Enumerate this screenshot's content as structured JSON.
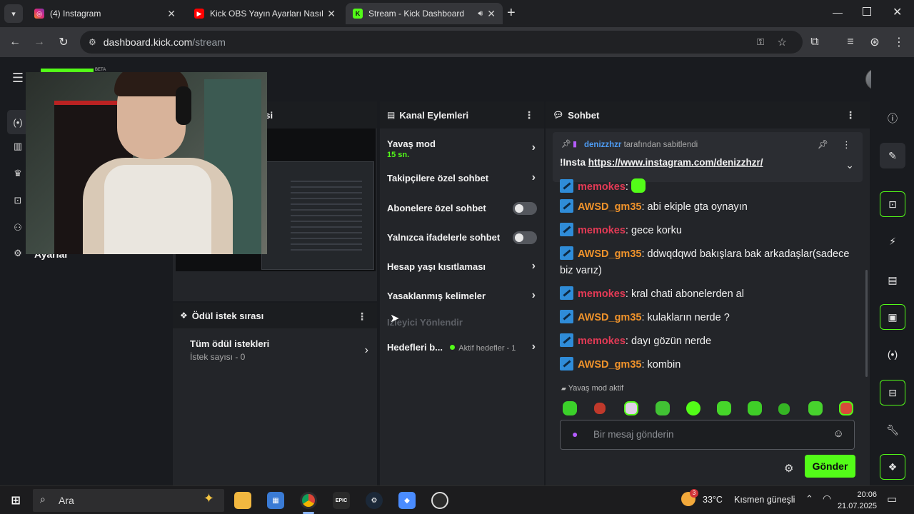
{
  "browser": {
    "tabs": [
      {
        "title": "(4) Instagram",
        "favicon": "instagram-icon",
        "color": "#d6249f"
      },
      {
        "title": "Kick OBS Yayın Ayarları Nasıl Ya",
        "favicon": "youtube-icon",
        "color": "#ff0000"
      },
      {
        "title": "Stream - Kick Dashboard",
        "favicon": "kick-icon",
        "color": "#53fc18"
      }
    ],
    "url_host": "dashboard.kick.com",
    "url_path": "/stream",
    "new_tab": "+"
  },
  "leftnav": {
    "partial_label": "Ayarlar",
    "beta_label": "BETA"
  },
  "stream_panel": {
    "title_partial": "asi"
  },
  "rewards_panel": {
    "title": "Ödül istek sırası",
    "item_title": "Tüm ödül istekleri",
    "item_sub": "İstek sayısı - 0"
  },
  "actions_panel": {
    "title": "Kanal Eylemleri",
    "slow_mode": {
      "label": "Yavaş mod",
      "value": "15 sn."
    },
    "rows": [
      {
        "label": "Takipçilere özel sohbet"
      },
      {
        "label": "Abonelere özel sohbet"
      },
      {
        "label": "Yalnızca ifadelerle sohbet"
      },
      {
        "label": "Hesap yaşı kısıtlaması"
      },
      {
        "label": "Yasaklanmış kelimeler"
      }
    ],
    "disabled_row": "Izleyici Yönlendir",
    "goals": {
      "label": "Hedefleri b...",
      "status": "Aktif hedefler - 1"
    }
  },
  "chat": {
    "title": "Sohbet",
    "pinned_by_user": "denizzhzr",
    "pinned_by_text": "tarafından sabitlendi",
    "pinned_prefix": "!Insta",
    "pinned_link": "https://www.instagram.com/denizzhzr/",
    "messages": [
      {
        "user": "memokes",
        "color": "red",
        "text": ""
      },
      {
        "user": "AWSD_gm35",
        "color": "orange",
        "text": "abi ekiple gta oynayın"
      },
      {
        "user": "memokes",
        "color": "red",
        "text": "gece korku"
      },
      {
        "user": "AWSD_gm35",
        "color": "orange",
        "text": "ddwqdqwd bakışlara bak arkadaşlar(sadece biz varız)"
      },
      {
        "user": "memokes",
        "color": "red",
        "text": "kral chati abonelerden al"
      },
      {
        "user": "AWSD_gm35",
        "color": "orange",
        "text": "kulakların nerde ?"
      },
      {
        "user": "memokes",
        "color": "red",
        "text": "dayı gözün nerde"
      },
      {
        "user": "AWSD_gm35",
        "color": "orange",
        "text": "kombin"
      }
    ],
    "slow_mode_notice": "Yavaş mod aktif",
    "input_placeholder": "Bir mesaj gönderin",
    "send_label": "Gönder"
  },
  "taskbar": {
    "search_placeholder": "Ara",
    "weather_temp": "33°C",
    "weather_desc": "Kısmen güneşli",
    "weather_badge": "3",
    "time": "20:06",
    "date": "21.07.2025",
    "epic_label": "EPIC"
  },
  "colors": {
    "kick_green": "#53fc18",
    "user_red": "#e23a55",
    "user_orange": "#f0932b",
    "link_blue": "#4e9cf5"
  }
}
